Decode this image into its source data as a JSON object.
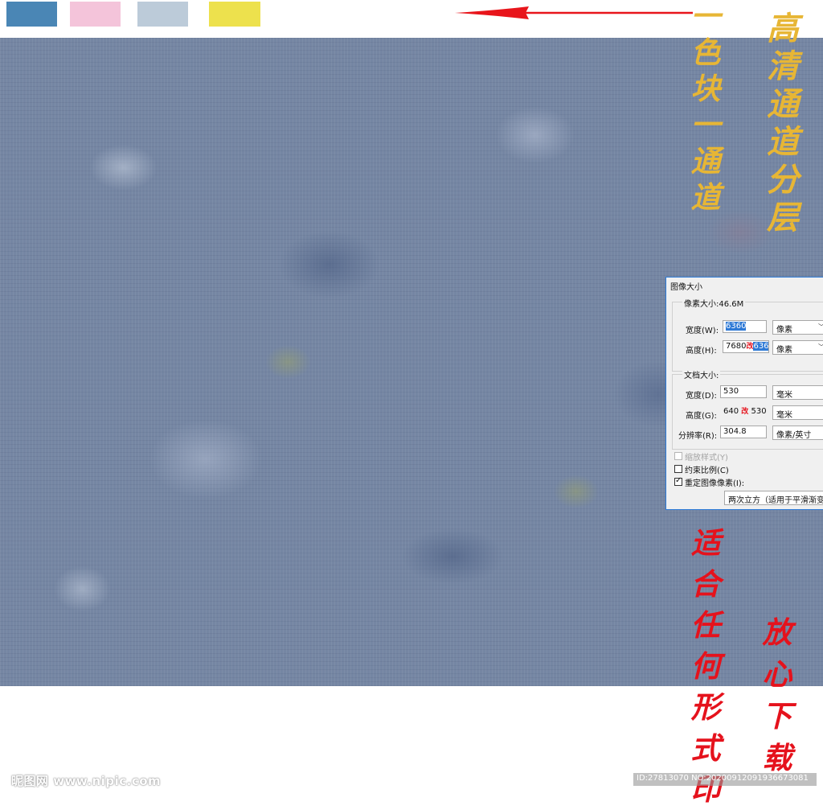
{
  "swatches": [
    {
      "color": "#4a86b5"
    },
    {
      "color": "#f4c4da"
    },
    {
      "color": "#bccbd9"
    },
    {
      "color": "#ede14d"
    }
  ],
  "colors": {
    "arrow": "#e8151b",
    "promo_gold": "#e7b635",
    "promo_red": "#e5121c",
    "texture_base": "#7586a3"
  },
  "promo": {
    "left_gold": "一色块一通道",
    "right_gold": "高清通道分层",
    "red_1": "适合任何形式印",
    "red_2": "放心下载"
  },
  "dialog": {
    "title": "图像大小",
    "pixel_size_label": "像素大小:46.6M",
    "width_label": "宽度(W):",
    "width_value": "6360",
    "width_unit": "像素",
    "height_label": "高度(H):",
    "height_value_old": "7680",
    "height_value_mark": "改",
    "height_value_new": "6360",
    "height_unit": "像素",
    "doc_size_label": "文档大小:",
    "doc_width_label": "宽度(D):",
    "doc_width_value": "530",
    "doc_width_unit": "毫米",
    "doc_height_label": "高度(G):",
    "doc_height_value_old": "640",
    "doc_height_value_mark": "改",
    "doc_height_value_new": "530",
    "doc_height_unit": "毫米",
    "resolution_label": "分辨率(R):",
    "resolution_value": "304.8",
    "resolution_unit": "像素/英寸",
    "scale_styles": "缩放样式(Y)",
    "constrain": "约束比例(C)",
    "resample": "重定图像像素(I):",
    "resample_method": "两次立方（适用于平滑渐变"
  },
  "watermark": {
    "site": "昵图网 www.nipic.com",
    "id": "ID:27813070 NO:20200912091936673081"
  }
}
